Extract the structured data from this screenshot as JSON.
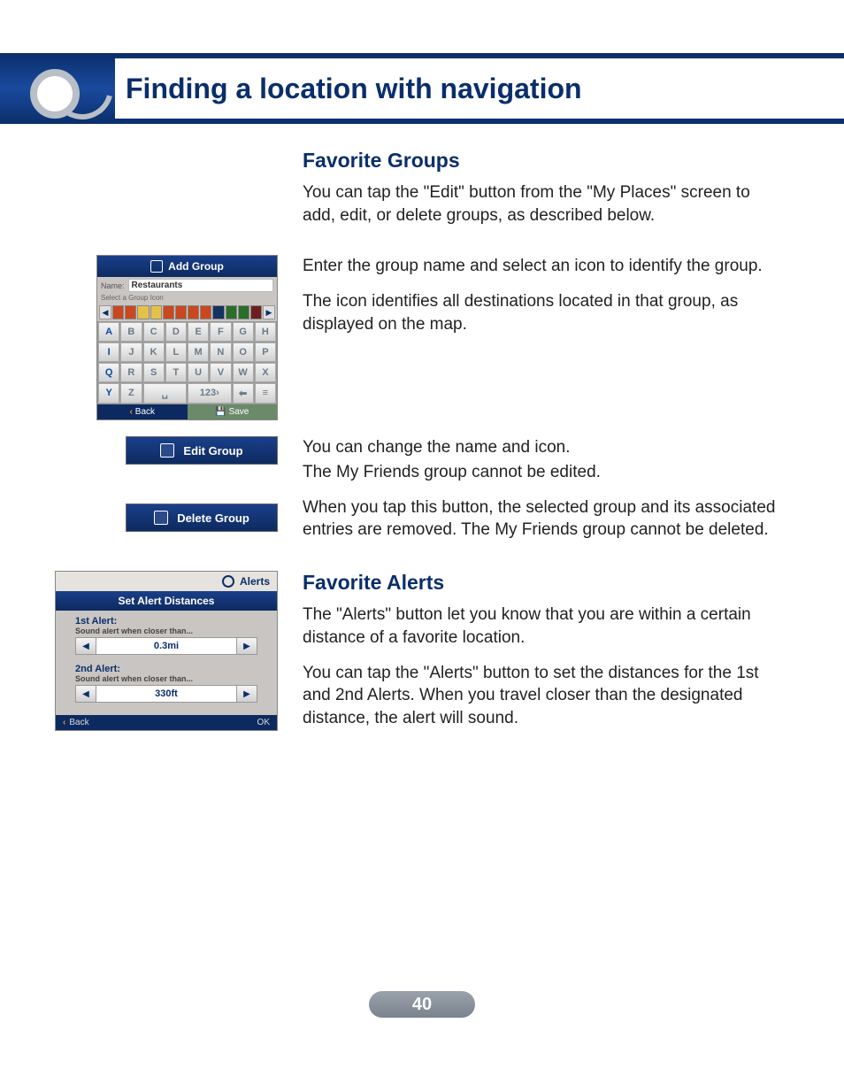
{
  "header": {
    "title": "Finding a location with navigation"
  },
  "favorite_groups": {
    "heading": "Favorite Groups",
    "intro": "You can tap the \"Edit\" button from the \"My Places\" screen to add, edit, or delete groups, as described below.",
    "add_p1": "Enter the group name and select an icon to identify the group.",
    "add_p2": "The icon identifies all destinations located in that group, as displayed on the map.",
    "edit_p1": "You can change the name and icon.",
    "edit_p2": "The My Friends group cannot be edited.",
    "delete_p": "When you tap this button, the selected group and its associated entries are removed. The My Friends group cannot be deleted."
  },
  "add_group_panel": {
    "title": "Add Group",
    "name_label": "Name:",
    "name_value": "Restaurants",
    "select_icon_label": "Select a Group Icon",
    "keys_row1": [
      "A",
      "B",
      "C",
      "D",
      "E",
      "F",
      "G",
      "H"
    ],
    "keys_row2": [
      "I",
      "J",
      "K",
      "L",
      "M",
      "N",
      "O",
      "P"
    ],
    "keys_row3": [
      "Q",
      "R",
      "S",
      "T",
      "U",
      "V",
      "W",
      "X"
    ],
    "keys_row4": [
      "Y",
      "Z",
      "␣",
      "123›",
      "⬅",
      "≡"
    ],
    "back": "Back",
    "save": "Save",
    "icon_colors": [
      "#c9481e",
      "#c9481e",
      "#e6c14a",
      "#e6c14a",
      "#c9481e",
      "#c9481e",
      "#c9481e",
      "#c9481e",
      "#14335f",
      "#2a6e2a",
      "#2a6e2a",
      "#6e1e1e"
    ]
  },
  "edit_button": {
    "label": "Edit Group"
  },
  "delete_button": {
    "label": "Delete Group"
  },
  "favorite_alerts": {
    "heading": "Favorite Alerts",
    "p1": "The \"Alerts\" button let you know that you are within a certain distance of a favorite location.",
    "p2": "You can tap the \"Alerts\" button to set the distances for the 1st and 2nd Alerts. When you travel closer than the designated distance, the alert will sound."
  },
  "alerts_panel": {
    "tab": "Alerts",
    "title": "Set Alert Distances",
    "alert1_label": "1st Alert:",
    "alert1_sub": "Sound alert when closer than...",
    "alert1_value": "0.3mi",
    "alert2_label": "2nd Alert:",
    "alert2_sub": "Sound alert when closer than...",
    "alert2_value": "330ft",
    "back": "Back",
    "ok": "OK"
  },
  "page_number": "40"
}
